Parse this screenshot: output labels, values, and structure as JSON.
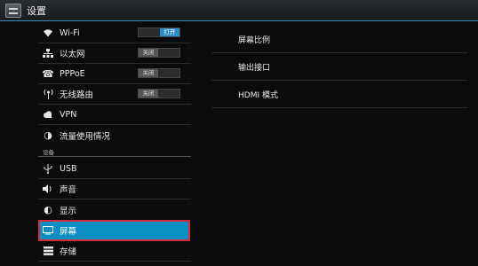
{
  "window": {
    "title": "设置"
  },
  "sidebar": {
    "items": [
      {
        "label": "Wi-Fi",
        "icon": "wifi-icon",
        "toggle": "打开"
      },
      {
        "label": "以太网",
        "icon": "ethernet-icon",
        "toggle": "关闭"
      },
      {
        "label": "PPPoE",
        "icon": "phone-icon",
        "toggle": "关闭"
      },
      {
        "label": "无线路由",
        "icon": "antenna-icon",
        "toggle": "关闭"
      },
      {
        "label": "VPN",
        "icon": "cloud-icon"
      },
      {
        "label": "流量使用情况",
        "icon": "data-usage-icon"
      }
    ],
    "section": "设备",
    "device_items": [
      {
        "label": "USB",
        "icon": "usb-icon"
      },
      {
        "label": "声音",
        "icon": "speaker-icon"
      },
      {
        "label": "显示",
        "icon": "display-icon"
      },
      {
        "label": "屏幕",
        "icon": "screen-icon"
      },
      {
        "label": "存储",
        "icon": "storage-icon"
      }
    ]
  },
  "detail": {
    "items": [
      {
        "label": "屏幕比例"
      },
      {
        "label": "输出接口"
      },
      {
        "label": "HDMI 模式"
      }
    ]
  },
  "colors": {
    "accent": "#0e8fc3",
    "highlight_border": "#d42a3a"
  }
}
